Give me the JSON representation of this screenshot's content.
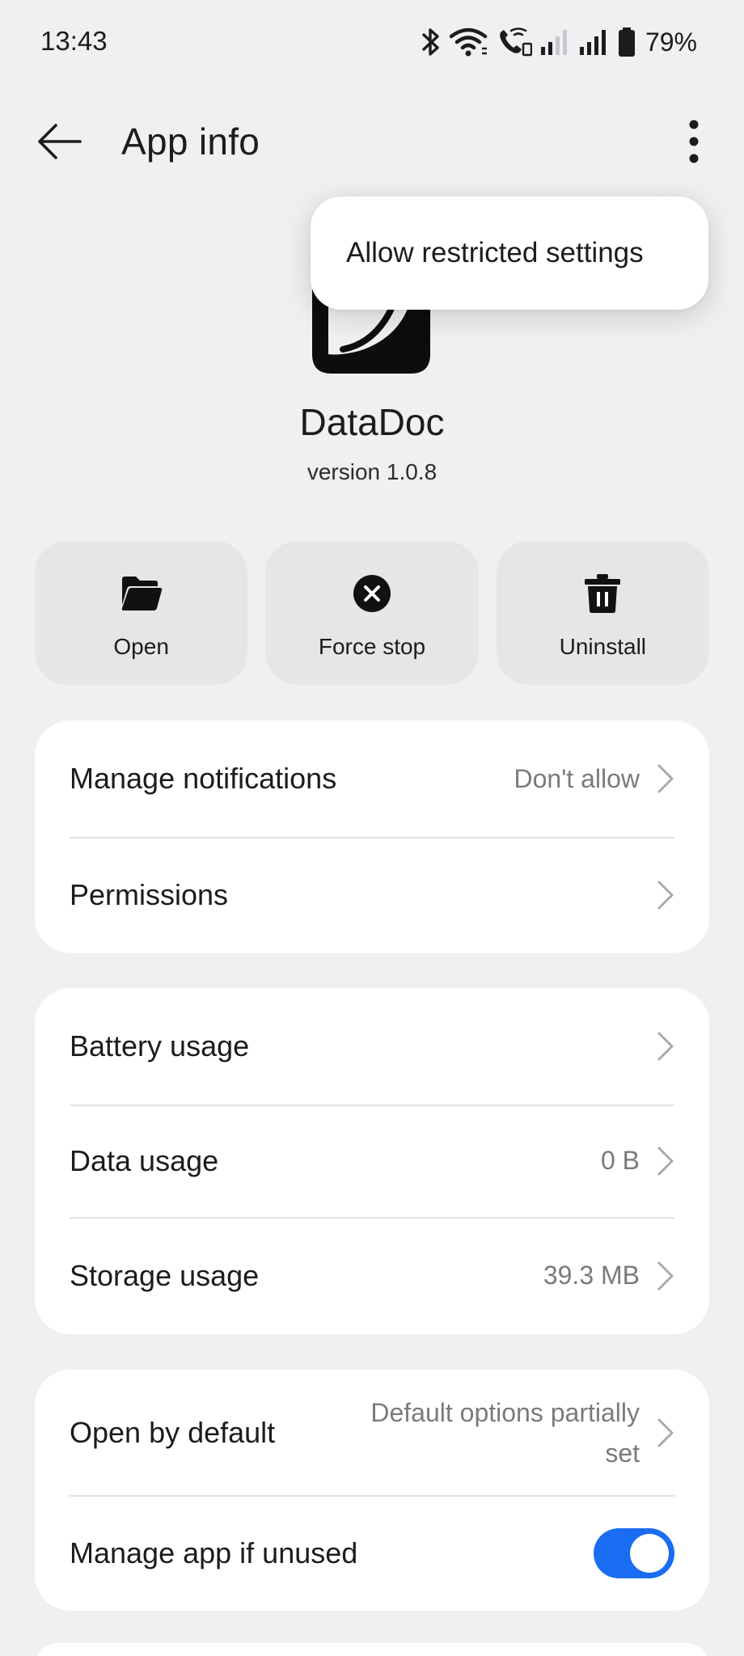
{
  "status_bar": {
    "time": "13:43",
    "battery": "79%",
    "icons": [
      "bluetooth-icon",
      "wifi-icon",
      "wifi-calling-icon",
      "signal-icon-sim1",
      "signal-icon-sim2",
      "battery-icon"
    ]
  },
  "app_bar": {
    "title": "App info",
    "back_icon": "arrow-left-icon",
    "more_icon": "more-vertical-icon"
  },
  "popup_menu": {
    "items": [
      {
        "label": "Allow restricted settings"
      }
    ]
  },
  "app": {
    "name": "DataDoc",
    "version": "version 1.0.8"
  },
  "actions": [
    {
      "label": "Open",
      "icon": "folder-icon"
    },
    {
      "label": "Force stop",
      "icon": "close-circle-icon"
    },
    {
      "label": "Uninstall",
      "icon": "trash-icon"
    }
  ],
  "card1": {
    "rows": [
      {
        "title": "Manage notifications",
        "value": "Don't allow"
      },
      {
        "title": "Permissions",
        "value": ""
      }
    ]
  },
  "card2": {
    "rows": [
      {
        "title": "Battery usage",
        "value": ""
      },
      {
        "title": "Data usage",
        "value": "0 B"
      },
      {
        "title": "Storage usage",
        "value": "39.3 MB"
      }
    ]
  },
  "card3": {
    "rows": [
      {
        "title": "Open by default",
        "value_line1": "Default options partially",
        "value_line2": "set"
      },
      {
        "title": "Manage app if unused",
        "toggle_on": true
      }
    ]
  },
  "colors": {
    "background": "#eff0f2",
    "card": "#ffffff",
    "action_button": "#e5e6e8",
    "accent": "#1a6cf2",
    "secondary_text": "#7a7a7f"
  }
}
